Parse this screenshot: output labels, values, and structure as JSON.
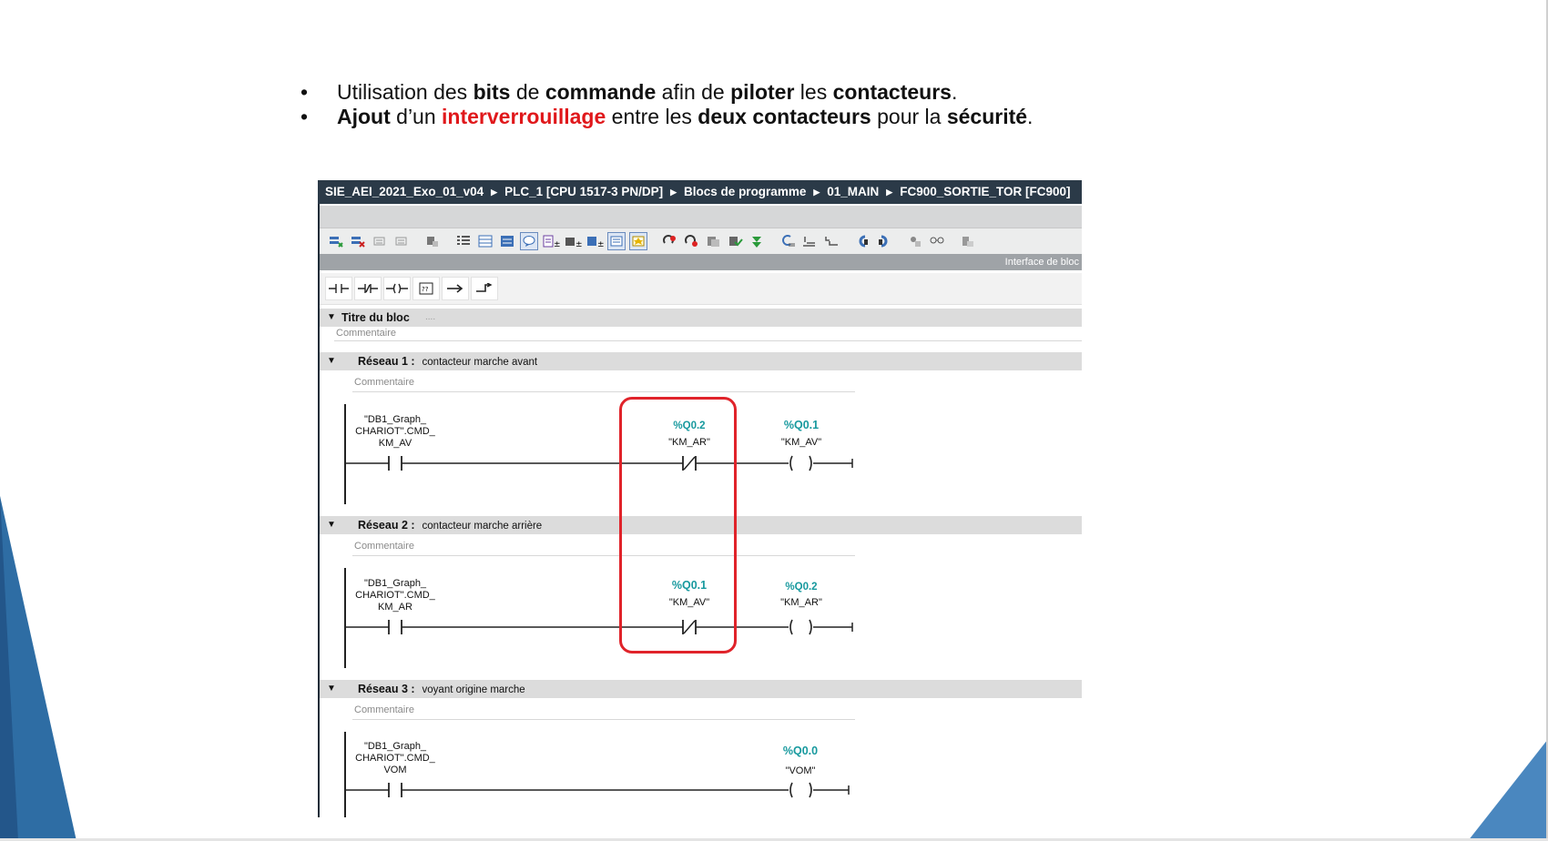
{
  "slide": {
    "bullets": [
      {
        "parts": [
          {
            "text": "Utilisation des ",
            "style": "normal"
          },
          {
            "text": "bits",
            "style": "bold"
          },
          {
            "text": " de ",
            "style": "normal"
          },
          {
            "text": "commande",
            "style": "bold"
          },
          {
            "text": " afin de ",
            "style": "normal"
          },
          {
            "text": "piloter",
            "style": "bold"
          },
          {
            "text": " les ",
            "style": "normal"
          },
          {
            "text": "contacteurs",
            "style": "bold"
          },
          {
            "text": ".",
            "style": "normal"
          }
        ]
      },
      {
        "parts": [
          {
            "text": "Ajout",
            "style": "bold"
          },
          {
            "text": " d’un ",
            "style": "normal"
          },
          {
            "text": "interverrouillage",
            "style": "red"
          },
          {
            "text": " entre les ",
            "style": "normal"
          },
          {
            "text": "deux contacteurs",
            "style": "bold"
          },
          {
            "text": " pour la ",
            "style": "normal"
          },
          {
            "text": "sécurité",
            "style": "bold"
          },
          {
            "text": ".",
            "style": "normal"
          }
        ]
      }
    ],
    "bullet_symbol": "•"
  },
  "editor": {
    "breadcrumb": [
      "SIE_AEI_2021_Exo_01_v04",
      "PLC_1 [CPU 1517-3 PN/DP]",
      "Blocs de programme",
      "01_MAIN",
      "FC900_SORTIE_TOR [FC900]"
    ],
    "interface_label": "Interface de bloc",
    "block_title": "Titre du bloc",
    "block_title_suffix": "....",
    "comment_placeholder": "Commentaire",
    "networks": [
      {
        "label": "Réseau 1 :",
        "description": "contacteur marche avant",
        "contact_lines": [
          "\"DB1_Graph_",
          "CHARIOT\".CMD_",
          "KM_AV"
        ],
        "interlock_address": "%Q0.2",
        "interlock_tag": "\"KM_AR\"",
        "coil_address": "%Q0.1",
        "coil_tag": "\"KM_AV\""
      },
      {
        "label": "Réseau 2 :",
        "description": "contacteur marche arrière",
        "contact_lines": [
          "\"DB1_Graph_",
          "CHARIOT\".CMD_",
          "KM_AR"
        ],
        "interlock_address": "%Q0.1",
        "interlock_tag": "\"KM_AV\"",
        "coil_address": "%Q0.2",
        "coil_tag": "\"KM_AR\""
      },
      {
        "label": "Réseau 3 :",
        "description": "voyant origine marche",
        "contact_lines": [
          "\"DB1_Graph_",
          "CHARIOT\".CMD_",
          "VOM"
        ],
        "coil_address": "%Q0.0",
        "coil_tag": "\"VOM\""
      }
    ],
    "colors": {
      "breadcrumb_bg": "#2b3a48",
      "address": "#17999e",
      "highlight": "#e0232a",
      "accent_blue": "#2e6da4"
    }
  }
}
